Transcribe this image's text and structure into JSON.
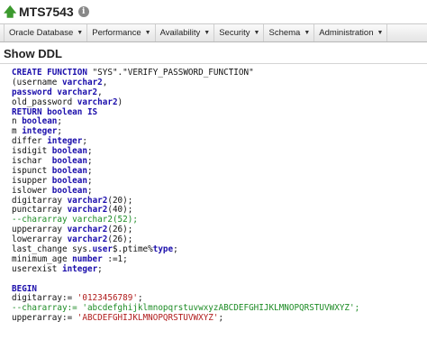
{
  "header": {
    "title": "MTS7543",
    "info_icon": "info-icon",
    "up_icon": "up-arrow-icon"
  },
  "menu": [
    {
      "label": "Oracle Database"
    },
    {
      "label": "Performance"
    },
    {
      "label": "Availability"
    },
    {
      "label": "Security"
    },
    {
      "label": "Schema"
    },
    {
      "label": "Administration"
    }
  ],
  "section_title": "Show DDL",
  "colors": {
    "keyword": "#1a0dab",
    "comment": "#1c8b24",
    "string": "#b01c1c",
    "up_arrow": "#3c9a2e"
  },
  "code_lines": [
    [
      {
        "t": "CREATE FUNCTION",
        "c": "kw"
      },
      {
        "t": " \"SYS\".\"VERIFY_PASSWORD_FUNCTION\"",
        "c": ""
      }
    ],
    [
      {
        "t": "(username ",
        "c": ""
      },
      {
        "t": "varchar2",
        "c": "kw"
      },
      {
        "t": ",",
        "c": ""
      }
    ],
    [
      {
        "t": "password ",
        "c": "kw"
      },
      {
        "t": "varchar2",
        "c": "kw"
      },
      {
        "t": ",",
        "c": ""
      }
    ],
    [
      {
        "t": "old_password ",
        "c": ""
      },
      {
        "t": "varchar2",
        "c": "kw"
      },
      {
        "t": ")",
        "c": ""
      }
    ],
    [
      {
        "t": "RETURN boolean IS",
        "c": "kw"
      }
    ],
    [
      {
        "t": "n ",
        "c": ""
      },
      {
        "t": "boolean",
        "c": "kw"
      },
      {
        "t": ";",
        "c": ""
      }
    ],
    [
      {
        "t": "m ",
        "c": ""
      },
      {
        "t": "integer",
        "c": "kw"
      },
      {
        "t": ";",
        "c": ""
      }
    ],
    [
      {
        "t": "differ ",
        "c": ""
      },
      {
        "t": "integer",
        "c": "kw"
      },
      {
        "t": ";",
        "c": ""
      }
    ],
    [
      {
        "t": "isdigit ",
        "c": ""
      },
      {
        "t": "boolean",
        "c": "kw"
      },
      {
        "t": ";",
        "c": ""
      }
    ],
    [
      {
        "t": "ischar  ",
        "c": ""
      },
      {
        "t": "boolean",
        "c": "kw"
      },
      {
        "t": ";",
        "c": ""
      }
    ],
    [
      {
        "t": "ispunct ",
        "c": ""
      },
      {
        "t": "boolean",
        "c": "kw"
      },
      {
        "t": ";",
        "c": ""
      }
    ],
    [
      {
        "t": "isupper ",
        "c": ""
      },
      {
        "t": "boolean",
        "c": "kw"
      },
      {
        "t": ";",
        "c": ""
      }
    ],
    [
      {
        "t": "islower ",
        "c": ""
      },
      {
        "t": "boolean",
        "c": "kw"
      },
      {
        "t": ";",
        "c": ""
      }
    ],
    [
      {
        "t": "digitarray ",
        "c": ""
      },
      {
        "t": "varchar2",
        "c": "kw"
      },
      {
        "t": "(20);",
        "c": ""
      }
    ],
    [
      {
        "t": "punctarray ",
        "c": ""
      },
      {
        "t": "varchar2",
        "c": "kw"
      },
      {
        "t": "(40);",
        "c": ""
      }
    ],
    [
      {
        "t": "--chararray varchar2(52);",
        "c": "cmt"
      }
    ],
    [
      {
        "t": "upperarray ",
        "c": ""
      },
      {
        "t": "varchar2",
        "c": "kw"
      },
      {
        "t": "(26);",
        "c": ""
      }
    ],
    [
      {
        "t": "lowerarray ",
        "c": ""
      },
      {
        "t": "varchar2",
        "c": "kw"
      },
      {
        "t": "(26);",
        "c": ""
      }
    ],
    [
      {
        "t": "last_change sys.",
        "c": ""
      },
      {
        "t": "user",
        "c": "kw"
      },
      {
        "t": "$.ptime%",
        "c": ""
      },
      {
        "t": "type",
        "c": "kw"
      },
      {
        "t": ";",
        "c": ""
      }
    ],
    [
      {
        "t": "minimum_age ",
        "c": ""
      },
      {
        "t": "number",
        "c": "kw"
      },
      {
        "t": " :=1;",
        "c": ""
      }
    ],
    [
      {
        "t": "userexist ",
        "c": ""
      },
      {
        "t": "integer",
        "c": "kw"
      },
      {
        "t": ";",
        "c": ""
      }
    ],
    [
      {
        "t": "",
        "c": ""
      }
    ],
    [
      {
        "t": "BEGIN",
        "c": "kw"
      }
    ],
    [
      {
        "t": "digitarray:= ",
        "c": ""
      },
      {
        "t": "'0123456789'",
        "c": "str"
      },
      {
        "t": ";",
        "c": ""
      }
    ],
    [
      {
        "t": "--chararray:= 'abcdefghijklmnopqrstuvwxyzABCDEFGHIJKLMNOPQRSTUVWXYZ';",
        "c": "cmt"
      }
    ],
    [
      {
        "t": "upperarray:= ",
        "c": ""
      },
      {
        "t": "'ABCDEFGHIJKLMNOPQRSTUVWXYZ'",
        "c": "str"
      },
      {
        "t": ";",
        "c": ""
      }
    ]
  ]
}
